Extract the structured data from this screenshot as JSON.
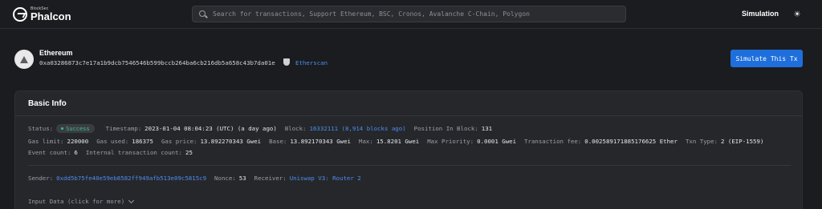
{
  "header": {
    "logo_small": "BlockSec",
    "logo_name": "Phalcon",
    "search_placeholder": "Search for transactions, Support Ethereum, BSC, Cronos, Avalanche C-Chain, Polygon",
    "simulation_label": "Simulation",
    "theme_icon": "sun-icon"
  },
  "tx": {
    "chain": "Ethereum",
    "hash": "0xa03286873c7e17a1b9dcb7546546b599bccb264ba6cb216db5a658c43b7da01e",
    "explorer_label": "Etherscan",
    "simulate_button": "Simulate This Tx"
  },
  "basic_info": {
    "title": "Basic Info",
    "status_label": "Status:",
    "status_value": "Success",
    "timestamp_label": "Timestamp:",
    "timestamp_value": "2023-01-04 08:04:23 (UTC) (a day ago)",
    "block_label": "Block:",
    "block_value": "16332111 (8,914 blocks ago)",
    "position_label": "Position In Block:",
    "position_value": "131",
    "gas_limit_label": "Gas limit:",
    "gas_limit_value": "220000",
    "gas_used_label": "Gas used:",
    "gas_used_value": "186375",
    "gas_price_label": "Gas price:",
    "gas_price_value": "13.892270343 Gwei",
    "base_label": "Base:",
    "base_value": "13.892170343 Gwei",
    "max_label": "Max:",
    "max_value": "15.8201 Gwei",
    "max_priority_label": "Max Priority:",
    "max_priority_value": "0.0001 Gwei",
    "tx_fee_label": "Transaction fee:",
    "tx_fee_value": "0.002589171885176625 Ether",
    "tx_type_label": "Txn Type:",
    "tx_type_value": "2 (EIP-1559)",
    "event_count_label": "Event count:",
    "event_count_value": "6",
    "internal_tx_label": "Internal transaction count:",
    "internal_tx_value": "25",
    "sender_label": "Sender:",
    "sender_value": "0xdd5b75fe40e59eb8582ff949afb513e09c5815c9",
    "nonce_label": "Nonce:",
    "nonce_value": "53",
    "receiver_label": "Receiver:",
    "receiver_value": "Uniswap V3: Router 2",
    "input_data_label": "Input Data (click for more)"
  },
  "colors": {
    "accent": "#1e6fdc",
    "link": "#4b8ef0",
    "success": "#39c08a",
    "background": "#1b1c1f",
    "card": "#26272b"
  }
}
